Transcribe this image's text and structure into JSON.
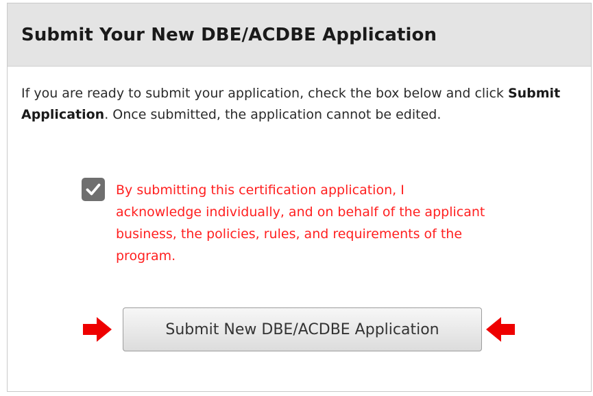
{
  "panel": {
    "title": "Submit Your New DBE/ACDBE Application"
  },
  "intro": {
    "text_before": "If you are ready to submit your application, check the box below and click ",
    "emphasis": "Submit Application",
    "text_after": ". Once submitted, the application cannot be edited."
  },
  "acknowledgement": {
    "checked": true,
    "text": "By submitting this certification application, I acknowledge individually, and on behalf of the applicant business, the policies, rules, and requirements of the program.",
    "color": "#ff1f1f"
  },
  "submit": {
    "label": "Submit New DBE/ACDBE Application",
    "pointer_icons": [
      "arrow-right-icon",
      "arrow-left-icon"
    ],
    "pointer_color": "#ee0000"
  }
}
